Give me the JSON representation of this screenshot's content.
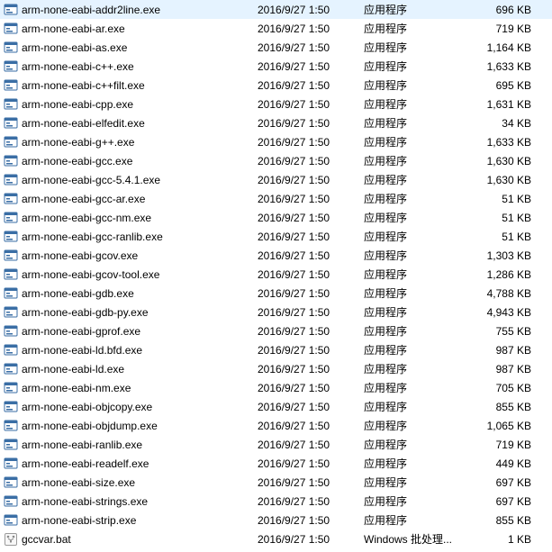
{
  "fileTypes": {
    "exe": "应用程序",
    "bat": "Windows 批处理..."
  },
  "files": [
    {
      "name": "arm-none-eabi-addr2line.exe",
      "date": "2016/9/27 1:50",
      "type": "exe",
      "size": "696 KB"
    },
    {
      "name": "arm-none-eabi-ar.exe",
      "date": "2016/9/27 1:50",
      "type": "exe",
      "size": "719 KB"
    },
    {
      "name": "arm-none-eabi-as.exe",
      "date": "2016/9/27 1:50",
      "type": "exe",
      "size": "1,164 KB"
    },
    {
      "name": "arm-none-eabi-c++.exe",
      "date": "2016/9/27 1:50",
      "type": "exe",
      "size": "1,633 KB"
    },
    {
      "name": "arm-none-eabi-c++filt.exe",
      "date": "2016/9/27 1:50",
      "type": "exe",
      "size": "695 KB"
    },
    {
      "name": "arm-none-eabi-cpp.exe",
      "date": "2016/9/27 1:50",
      "type": "exe",
      "size": "1,631 KB"
    },
    {
      "name": "arm-none-eabi-elfedit.exe",
      "date": "2016/9/27 1:50",
      "type": "exe",
      "size": "34 KB"
    },
    {
      "name": "arm-none-eabi-g++.exe",
      "date": "2016/9/27 1:50",
      "type": "exe",
      "size": "1,633 KB"
    },
    {
      "name": "arm-none-eabi-gcc.exe",
      "date": "2016/9/27 1:50",
      "type": "exe",
      "size": "1,630 KB"
    },
    {
      "name": "arm-none-eabi-gcc-5.4.1.exe",
      "date": "2016/9/27 1:50",
      "type": "exe",
      "size": "1,630 KB"
    },
    {
      "name": "arm-none-eabi-gcc-ar.exe",
      "date": "2016/9/27 1:50",
      "type": "exe",
      "size": "51 KB"
    },
    {
      "name": "arm-none-eabi-gcc-nm.exe",
      "date": "2016/9/27 1:50",
      "type": "exe",
      "size": "51 KB"
    },
    {
      "name": "arm-none-eabi-gcc-ranlib.exe",
      "date": "2016/9/27 1:50",
      "type": "exe",
      "size": "51 KB"
    },
    {
      "name": "arm-none-eabi-gcov.exe",
      "date": "2016/9/27 1:50",
      "type": "exe",
      "size": "1,303 KB"
    },
    {
      "name": "arm-none-eabi-gcov-tool.exe",
      "date": "2016/9/27 1:50",
      "type": "exe",
      "size": "1,286 KB"
    },
    {
      "name": "arm-none-eabi-gdb.exe",
      "date": "2016/9/27 1:50",
      "type": "exe",
      "size": "4,788 KB"
    },
    {
      "name": "arm-none-eabi-gdb-py.exe",
      "date": "2016/9/27 1:50",
      "type": "exe",
      "size": "4,943 KB"
    },
    {
      "name": "arm-none-eabi-gprof.exe",
      "date": "2016/9/27 1:50",
      "type": "exe",
      "size": "755 KB"
    },
    {
      "name": "arm-none-eabi-ld.bfd.exe",
      "date": "2016/9/27 1:50",
      "type": "exe",
      "size": "987 KB"
    },
    {
      "name": "arm-none-eabi-ld.exe",
      "date": "2016/9/27 1:50",
      "type": "exe",
      "size": "987 KB"
    },
    {
      "name": "arm-none-eabi-nm.exe",
      "date": "2016/9/27 1:50",
      "type": "exe",
      "size": "705 KB"
    },
    {
      "name": "arm-none-eabi-objcopy.exe",
      "date": "2016/9/27 1:50",
      "type": "exe",
      "size": "855 KB"
    },
    {
      "name": "arm-none-eabi-objdump.exe",
      "date": "2016/9/27 1:50",
      "type": "exe",
      "size": "1,065 KB"
    },
    {
      "name": "arm-none-eabi-ranlib.exe",
      "date": "2016/9/27 1:50",
      "type": "exe",
      "size": "719 KB"
    },
    {
      "name": "arm-none-eabi-readelf.exe",
      "date": "2016/9/27 1:50",
      "type": "exe",
      "size": "449 KB"
    },
    {
      "name": "arm-none-eabi-size.exe",
      "date": "2016/9/27 1:50",
      "type": "exe",
      "size": "697 KB"
    },
    {
      "name": "arm-none-eabi-strings.exe",
      "date": "2016/9/27 1:50",
      "type": "exe",
      "size": "697 KB"
    },
    {
      "name": "arm-none-eabi-strip.exe",
      "date": "2016/9/27 1:50",
      "type": "exe",
      "size": "855 KB"
    },
    {
      "name": "gccvar.bat",
      "date": "2016/9/27 1:50",
      "type": "bat",
      "size": "1 KB"
    }
  ]
}
